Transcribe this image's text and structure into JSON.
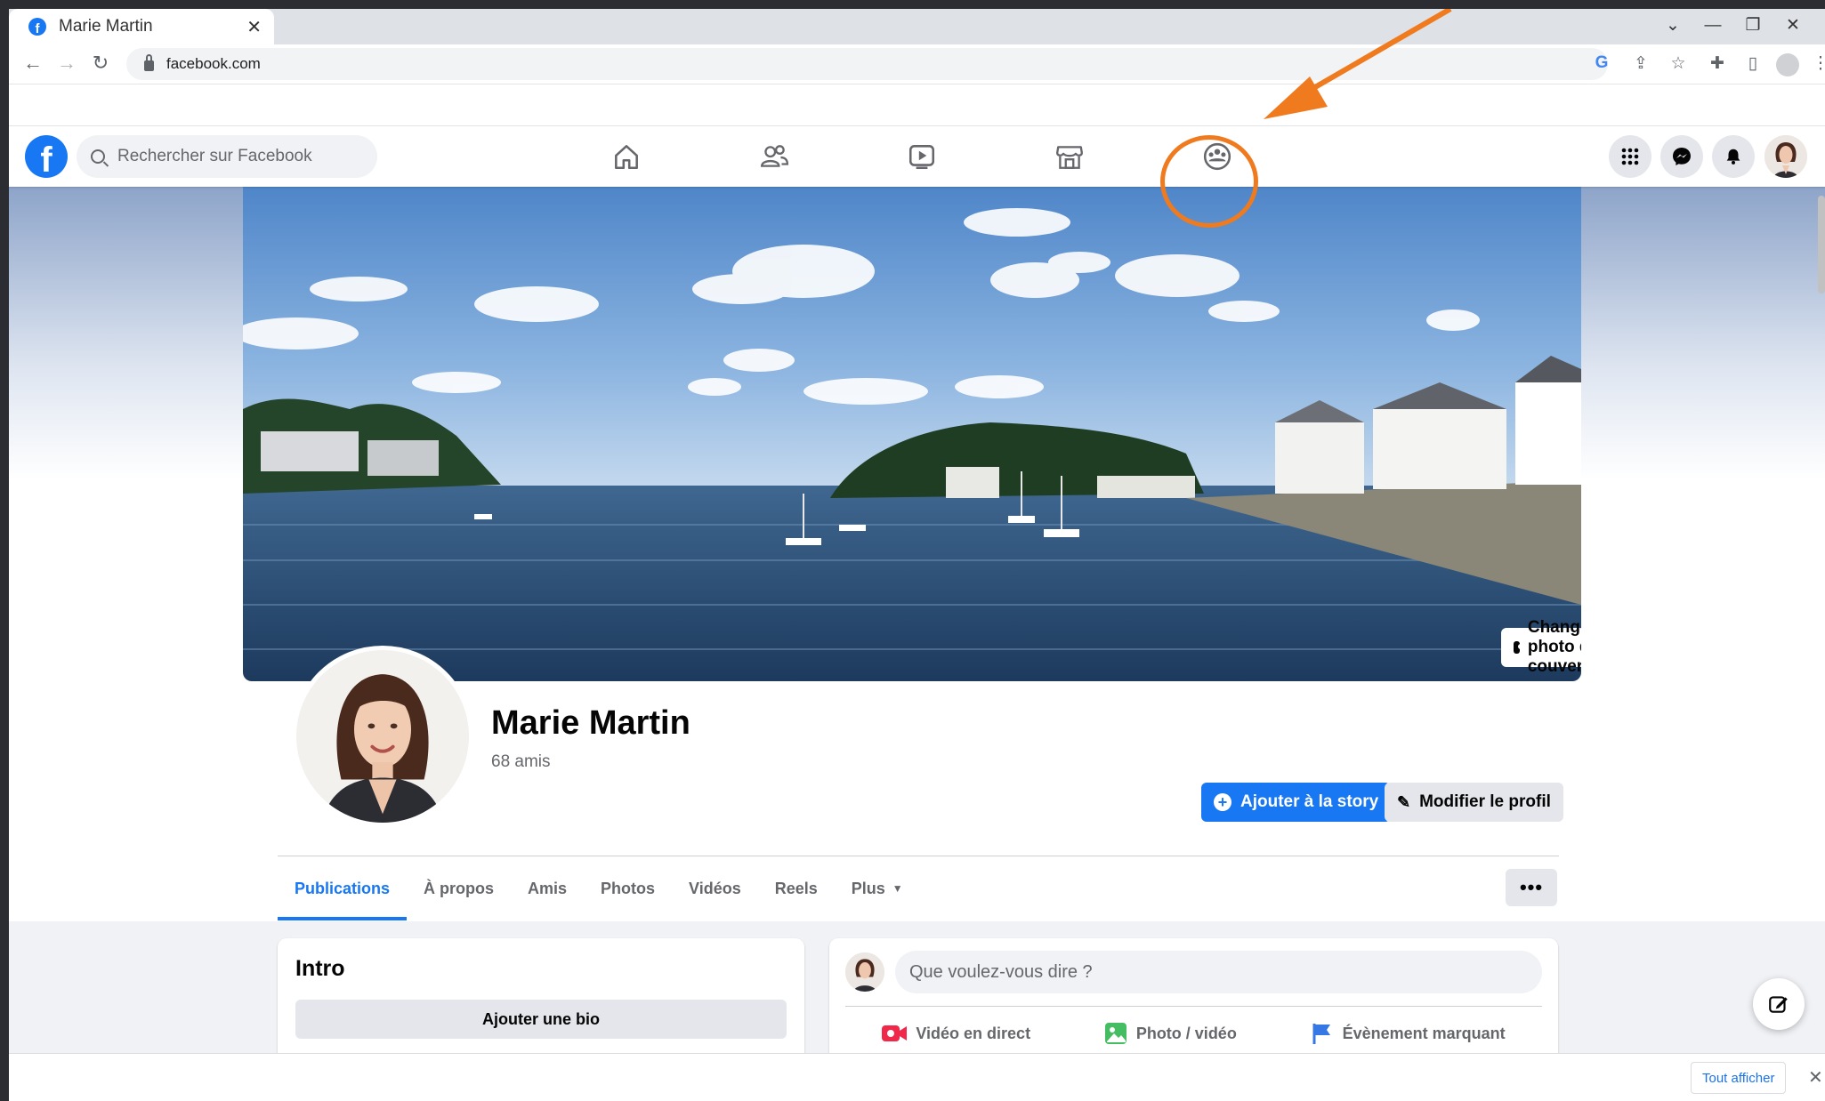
{
  "browser": {
    "tab_title": "Marie Martin",
    "tab_close": "✕",
    "url": "facebook.com",
    "window_controls": [
      "⌄",
      "—",
      "❐",
      "✕"
    ]
  },
  "facebook": {
    "search_placeholder": "Rechercher sur Facebook",
    "logo_letter": "f",
    "nav_icons": [
      "home-icon",
      "friends-icon",
      "watch-icon",
      "marketplace-icon",
      "groups-icon"
    ],
    "highlight_color": "#f07a1e"
  },
  "profile": {
    "cover_button": "Changer la photo de couverture",
    "name": "Marie Martin",
    "friends_count": "68 amis",
    "add_story": "Ajouter à la story",
    "edit_profile": "Modifier le profil",
    "tabs": [
      "Publications",
      "À propos",
      "Amis",
      "Photos",
      "Vidéos",
      "Reels",
      "Plus"
    ],
    "more_menu": "•••"
  },
  "intro": {
    "title": "Intro",
    "add_bio": "Ajouter une bio"
  },
  "composer": {
    "placeholder": "Que voulez-vous dire ?",
    "actions": [
      "Vidéo en direct",
      "Photo / vidéo",
      "Évènement marquant"
    ]
  },
  "download_bar": {
    "show_all": "Tout afficher",
    "close": "✕"
  },
  "colors": {
    "facebook_blue": "#1877f2",
    "annotation_orange": "#f07a1e"
  }
}
